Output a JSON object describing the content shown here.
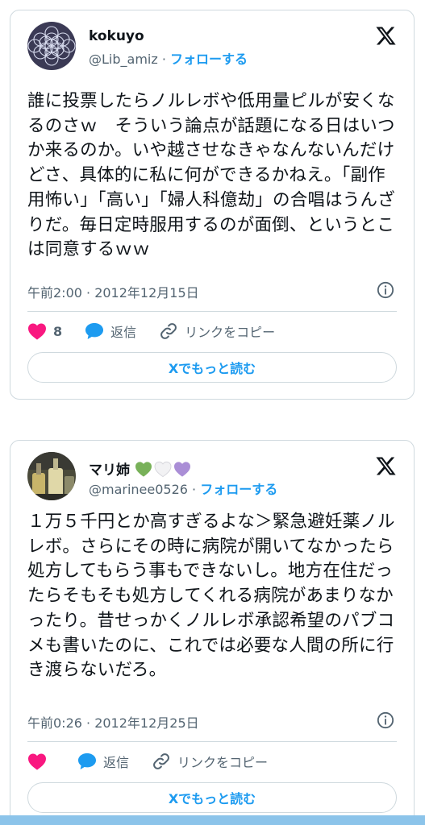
{
  "tweets": [
    {
      "name": "kokuyo",
      "handle": "@Lib_amiz",
      "separator": " · ",
      "follow": "フォローする",
      "text": "誰に投票したらノルレボや低用量ピルが安くなるのさｗ　そういう論点が話題になる日はいつか来るのか。いや越させなきゃなんないんだけどさ、具体的に私に何ができるかねえ。「副作用怖い」「高い」「婦人科億劫」の合唱はうんざりだ。毎日定時服用するのが面倒、というとこは同意するｗｗ",
      "timestamp": "午前2:00 · 2012年12月15日",
      "like_count": "8",
      "reply_label": "返信",
      "copy_link_label": "リンクをコピー",
      "read_more_label": "Xでもっと読む"
    },
    {
      "name": "マリ姉",
      "handle": "@marinee0526",
      "separator": " · ",
      "follow": "フォローする",
      "text": "１万５千円とか高すぎるよな＞緊急避妊薬ノルレボ。さらにその時に病院が開いてなかったら処方してもらう事もできないし。地方在住だったらそもそも処方してくれる病院があまりなかったり。昔せっかくノルレボ承認希望のパブコメも書いたのに、これでは必要な人間の所に行き渡らないだろ。",
      "timestamp": "午前0:26 · 2012年12月25日",
      "like_count": "",
      "reply_label": "返信",
      "copy_link_label": "リンクをコピー",
      "read_more_label": "Xでもっと読む",
      "name_hearts": [
        "green-heart",
        "white-heart",
        "purple-heart"
      ]
    }
  ],
  "colors": {
    "accent": "#1d9bf0",
    "like": "#f91880",
    "text": "#0f1419",
    "muted": "#536471",
    "border": "#cfd9de",
    "green_heart": "#78b159",
    "purple_heart": "#aa8ed6"
  },
  "icons": [
    "x-logo-icon",
    "info-icon",
    "heart-icon",
    "reply-bubble-icon",
    "link-icon"
  ]
}
